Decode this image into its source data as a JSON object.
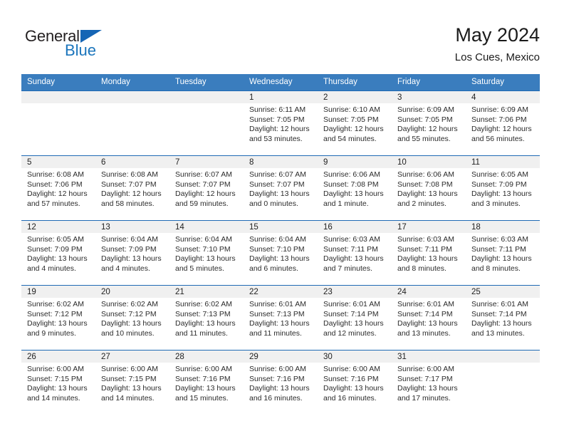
{
  "brand": {
    "name_top": "General",
    "name_bottom": "Blue",
    "triangle_color": "#1565b5",
    "text_color": "#231f20",
    "blue_color": "#1b75bc"
  },
  "header": {
    "title": "May 2024",
    "subtitle": "Los Cues, Mexico"
  },
  "theme": {
    "header_blue": "#3a7dbe",
    "row_line_blue": "#1f6ab5",
    "daynum_band": "#f0f0f0",
    "text": "#2b2b2b"
  },
  "weekdays": [
    "Sunday",
    "Monday",
    "Tuesday",
    "Wednesday",
    "Thursday",
    "Friday",
    "Saturday"
  ],
  "weeks": [
    [
      {
        "day": "",
        "empty": true
      },
      {
        "day": "",
        "empty": true
      },
      {
        "day": "",
        "empty": true
      },
      {
        "day": "1",
        "sunrise": "Sunrise: 6:11 AM",
        "sunset": "Sunset: 7:05 PM",
        "daylight1": "Daylight: 12 hours",
        "daylight2": "and 53 minutes."
      },
      {
        "day": "2",
        "sunrise": "Sunrise: 6:10 AM",
        "sunset": "Sunset: 7:05 PM",
        "daylight1": "Daylight: 12 hours",
        "daylight2": "and 54 minutes."
      },
      {
        "day": "3",
        "sunrise": "Sunrise: 6:09 AM",
        "sunset": "Sunset: 7:05 PM",
        "daylight1": "Daylight: 12 hours",
        "daylight2": "and 55 minutes."
      },
      {
        "day": "4",
        "sunrise": "Sunrise: 6:09 AM",
        "sunset": "Sunset: 7:06 PM",
        "daylight1": "Daylight: 12 hours",
        "daylight2": "and 56 minutes."
      }
    ],
    [
      {
        "day": "5",
        "sunrise": "Sunrise: 6:08 AM",
        "sunset": "Sunset: 7:06 PM",
        "daylight1": "Daylight: 12 hours",
        "daylight2": "and 57 minutes."
      },
      {
        "day": "6",
        "sunrise": "Sunrise: 6:08 AM",
        "sunset": "Sunset: 7:07 PM",
        "daylight1": "Daylight: 12 hours",
        "daylight2": "and 58 minutes."
      },
      {
        "day": "7",
        "sunrise": "Sunrise: 6:07 AM",
        "sunset": "Sunset: 7:07 PM",
        "daylight1": "Daylight: 12 hours",
        "daylight2": "and 59 minutes."
      },
      {
        "day": "8",
        "sunrise": "Sunrise: 6:07 AM",
        "sunset": "Sunset: 7:07 PM",
        "daylight1": "Daylight: 13 hours",
        "daylight2": "and 0 minutes."
      },
      {
        "day": "9",
        "sunrise": "Sunrise: 6:06 AM",
        "sunset": "Sunset: 7:08 PM",
        "daylight1": "Daylight: 13 hours",
        "daylight2": "and 1 minute."
      },
      {
        "day": "10",
        "sunrise": "Sunrise: 6:06 AM",
        "sunset": "Sunset: 7:08 PM",
        "daylight1": "Daylight: 13 hours",
        "daylight2": "and 2 minutes."
      },
      {
        "day": "11",
        "sunrise": "Sunrise: 6:05 AM",
        "sunset": "Sunset: 7:09 PM",
        "daylight1": "Daylight: 13 hours",
        "daylight2": "and 3 minutes."
      }
    ],
    [
      {
        "day": "12",
        "sunrise": "Sunrise: 6:05 AM",
        "sunset": "Sunset: 7:09 PM",
        "daylight1": "Daylight: 13 hours",
        "daylight2": "and 4 minutes."
      },
      {
        "day": "13",
        "sunrise": "Sunrise: 6:04 AM",
        "sunset": "Sunset: 7:09 PM",
        "daylight1": "Daylight: 13 hours",
        "daylight2": "and 4 minutes."
      },
      {
        "day": "14",
        "sunrise": "Sunrise: 6:04 AM",
        "sunset": "Sunset: 7:10 PM",
        "daylight1": "Daylight: 13 hours",
        "daylight2": "and 5 minutes."
      },
      {
        "day": "15",
        "sunrise": "Sunrise: 6:04 AM",
        "sunset": "Sunset: 7:10 PM",
        "daylight1": "Daylight: 13 hours",
        "daylight2": "and 6 minutes."
      },
      {
        "day": "16",
        "sunrise": "Sunrise: 6:03 AM",
        "sunset": "Sunset: 7:11 PM",
        "daylight1": "Daylight: 13 hours",
        "daylight2": "and 7 minutes."
      },
      {
        "day": "17",
        "sunrise": "Sunrise: 6:03 AM",
        "sunset": "Sunset: 7:11 PM",
        "daylight1": "Daylight: 13 hours",
        "daylight2": "and 8 minutes."
      },
      {
        "day": "18",
        "sunrise": "Sunrise: 6:03 AM",
        "sunset": "Sunset: 7:11 PM",
        "daylight1": "Daylight: 13 hours",
        "daylight2": "and 8 minutes."
      }
    ],
    [
      {
        "day": "19",
        "sunrise": "Sunrise: 6:02 AM",
        "sunset": "Sunset: 7:12 PM",
        "daylight1": "Daylight: 13 hours",
        "daylight2": "and 9 minutes."
      },
      {
        "day": "20",
        "sunrise": "Sunrise: 6:02 AM",
        "sunset": "Sunset: 7:12 PM",
        "daylight1": "Daylight: 13 hours",
        "daylight2": "and 10 minutes."
      },
      {
        "day": "21",
        "sunrise": "Sunrise: 6:02 AM",
        "sunset": "Sunset: 7:13 PM",
        "daylight1": "Daylight: 13 hours",
        "daylight2": "and 11 minutes."
      },
      {
        "day": "22",
        "sunrise": "Sunrise: 6:01 AM",
        "sunset": "Sunset: 7:13 PM",
        "daylight1": "Daylight: 13 hours",
        "daylight2": "and 11 minutes."
      },
      {
        "day": "23",
        "sunrise": "Sunrise: 6:01 AM",
        "sunset": "Sunset: 7:14 PM",
        "daylight1": "Daylight: 13 hours",
        "daylight2": "and 12 minutes."
      },
      {
        "day": "24",
        "sunrise": "Sunrise: 6:01 AM",
        "sunset": "Sunset: 7:14 PM",
        "daylight1": "Daylight: 13 hours",
        "daylight2": "and 13 minutes."
      },
      {
        "day": "25",
        "sunrise": "Sunrise: 6:01 AM",
        "sunset": "Sunset: 7:14 PM",
        "daylight1": "Daylight: 13 hours",
        "daylight2": "and 13 minutes."
      }
    ],
    [
      {
        "day": "26",
        "sunrise": "Sunrise: 6:00 AM",
        "sunset": "Sunset: 7:15 PM",
        "daylight1": "Daylight: 13 hours",
        "daylight2": "and 14 minutes."
      },
      {
        "day": "27",
        "sunrise": "Sunrise: 6:00 AM",
        "sunset": "Sunset: 7:15 PM",
        "daylight1": "Daylight: 13 hours",
        "daylight2": "and 14 minutes."
      },
      {
        "day": "28",
        "sunrise": "Sunrise: 6:00 AM",
        "sunset": "Sunset: 7:16 PM",
        "daylight1": "Daylight: 13 hours",
        "daylight2": "and 15 minutes."
      },
      {
        "day": "29",
        "sunrise": "Sunrise: 6:00 AM",
        "sunset": "Sunset: 7:16 PM",
        "daylight1": "Daylight: 13 hours",
        "daylight2": "and 16 minutes."
      },
      {
        "day": "30",
        "sunrise": "Sunrise: 6:00 AM",
        "sunset": "Sunset: 7:16 PM",
        "daylight1": "Daylight: 13 hours",
        "daylight2": "and 16 minutes."
      },
      {
        "day": "31",
        "sunrise": "Sunrise: 6:00 AM",
        "sunset": "Sunset: 7:17 PM",
        "daylight1": "Daylight: 13 hours",
        "daylight2": "and 17 minutes."
      },
      {
        "day": "",
        "empty": true
      }
    ]
  ]
}
